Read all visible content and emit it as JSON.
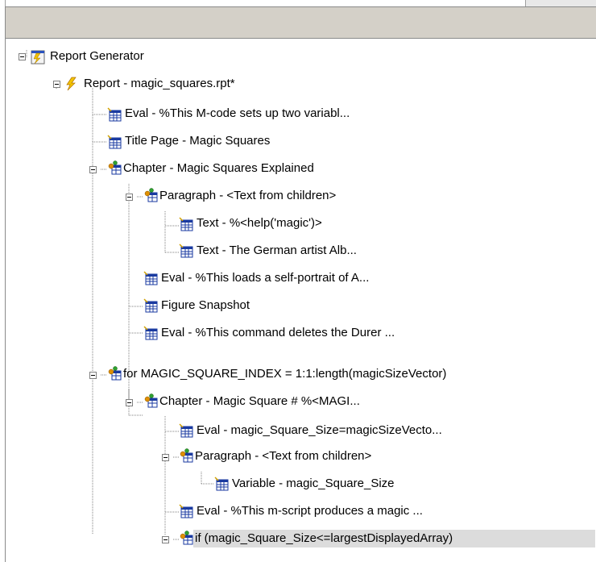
{
  "header": {
    "title": ""
  },
  "tree": {
    "nodes": [
      {
        "label": "Report Generator"
      },
      {
        "label": "Report - magic_squares.rpt*"
      },
      {
        "label": "Eval - %This M-code sets up two variabl..."
      },
      {
        "label": "Title Page - Magic Squares"
      },
      {
        "label": "Chapter - Magic Squares Explained"
      },
      {
        "label": "Paragraph - <Text from children>"
      },
      {
        "label": "Text - %<help('magic')>"
      },
      {
        "label": "Text - The German artist Alb..."
      },
      {
        "label": "Eval - %This loads a self-portrait of A..."
      },
      {
        "label": "Figure Snapshot"
      },
      {
        "label": "Eval - %This command deletes the Durer ..."
      },
      {
        "label": "for MAGIC_SQUARE_INDEX = 1:1:length(magicSizeVector)"
      },
      {
        "label": "Chapter - Magic Square # %<MAGI..."
      },
      {
        "label": "Eval - magic_Square_Size=magicSizeVecto..."
      },
      {
        "label": "Paragraph - <Text from children>"
      },
      {
        "label": "Variable - magic_Square_Size"
      },
      {
        "label": "Eval - %This m-script produces a magic ..."
      },
      {
        "label": "if (magic_Square_Size<=largestDisplayedArray)"
      }
    ]
  },
  "colors": {
    "header_bg": "#d4d0c8",
    "selection_bg": "#dcdcdc",
    "tree_line": "#808080"
  }
}
